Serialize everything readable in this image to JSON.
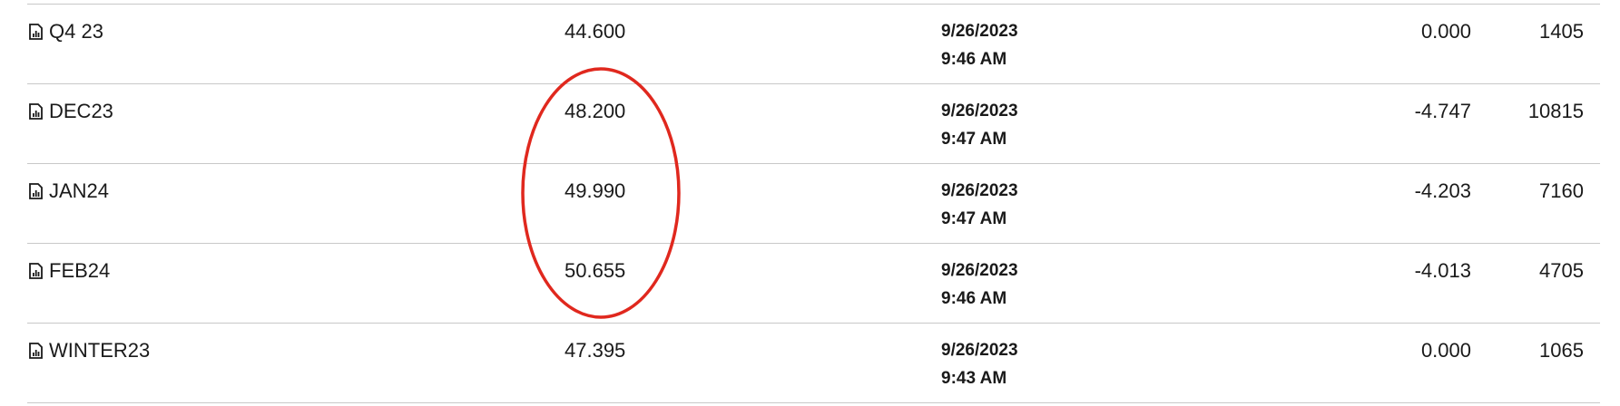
{
  "rows": [
    {
      "symbol": "Q4 23",
      "price": "44.600",
      "date": "9/26/2023",
      "time": "9:46 AM",
      "change": "0.000",
      "volume": "1405"
    },
    {
      "symbol": "DEC23",
      "price": "48.200",
      "date": "9/26/2023",
      "time": "9:47 AM",
      "change": "-4.747",
      "volume": "10815"
    },
    {
      "symbol": "JAN24",
      "price": "49.990",
      "date": "9/26/2023",
      "time": "9:47 AM",
      "change": "-4.203",
      "volume": "7160"
    },
    {
      "symbol": "FEB24",
      "price": "50.655",
      "date": "9/26/2023",
      "time": "9:46 AM",
      "change": "-4.013",
      "volume": "4705"
    },
    {
      "symbol": "WINTER23",
      "price": "47.395",
      "date": "9/26/2023",
      "time": "9:43 AM",
      "change": "0.000",
      "volume": "1065"
    }
  ],
  "row_icon": "chart-document-icon",
  "annotation": {
    "shape": "ellipse",
    "color": "#e0281e",
    "highlights": "price values for DEC23, JAN24, FEB24"
  }
}
